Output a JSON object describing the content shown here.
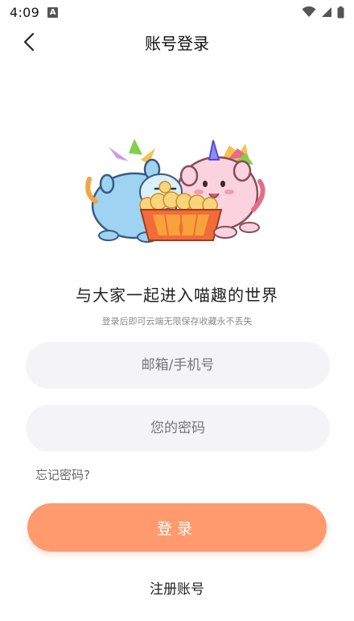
{
  "status_bar": {
    "time": "4:09",
    "notification_icon": "a-icon",
    "wifi_icon": "wifi-icon",
    "signal_icon": "signal-icon",
    "battery_icon": "battery-icon"
  },
  "header": {
    "title": "账号登录",
    "back_icon": "chevron-left-icon"
  },
  "illustration": {
    "name": "two-unicorn-cats-popcorn-illustration"
  },
  "slogan": "与大家一起进入喵趣的世界",
  "subslogan": "登录后即可云端无限保存收藏永不丢失",
  "form": {
    "email_placeholder": "邮箱/手机号",
    "email_value": "",
    "password_placeholder": "您的密码",
    "password_value": ""
  },
  "forgot_password": "忘记密码?",
  "login_button": "登录",
  "register_link": "注册账号",
  "colors": {
    "accent": "#ff9a6e",
    "input_bg": "#f4f4f6",
    "text_primary": "#222222",
    "text_secondary": "#8a8a8a"
  }
}
